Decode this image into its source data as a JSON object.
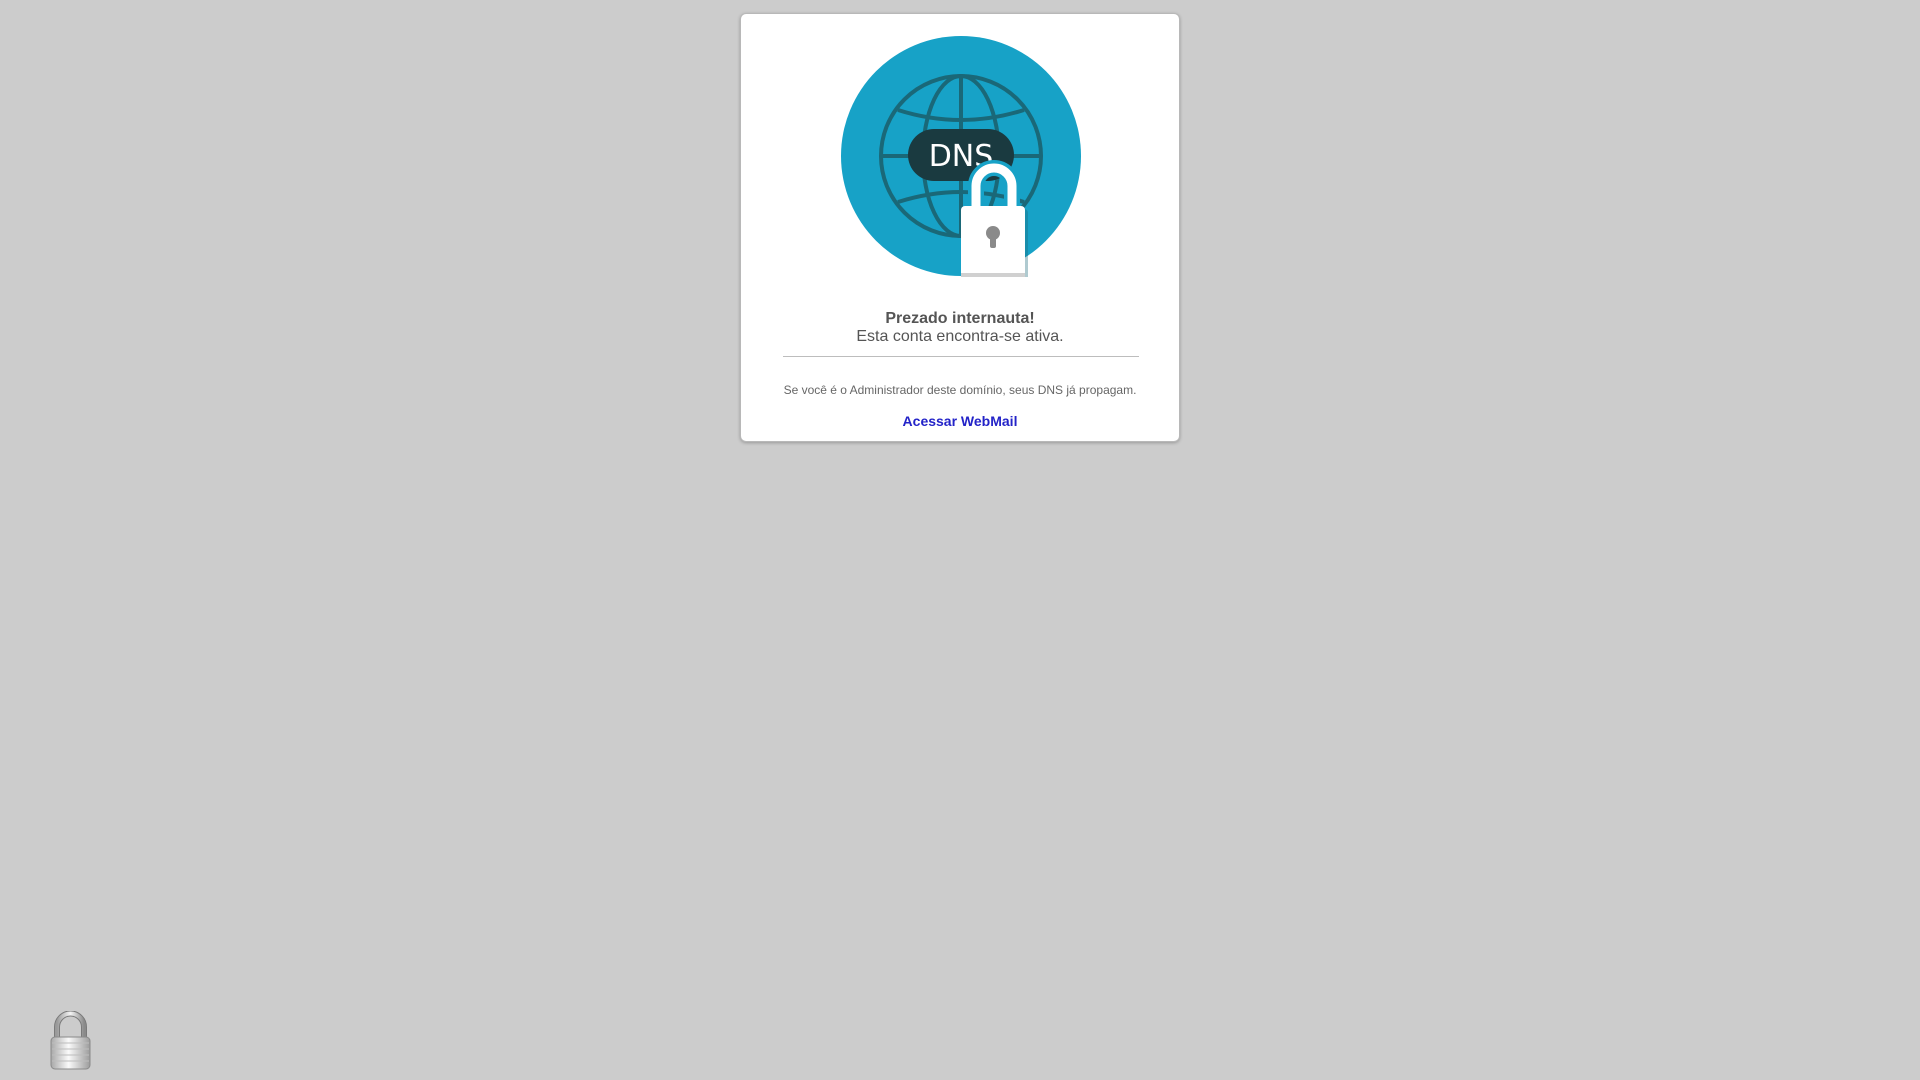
{
  "logo": {
    "badge_text": "DNS",
    "icon": "dns-globe-lock-icon",
    "colors": {
      "circle": "#17a2c7",
      "globe_lines": "#1a6878",
      "badge": "#1a3a40",
      "lock": "#ffffff"
    }
  },
  "message": {
    "heading": "Prezado internauta!",
    "subheading": "Esta conta encontra-se ativa.",
    "info": "Se você é o Administrador deste domínio, seus DNS já propagam."
  },
  "links": {
    "webmail": "Acessar WebMail"
  },
  "footer": {
    "icon": "padlock-icon"
  },
  "colors": {
    "background": "#cccccc",
    "card": "#ffffff",
    "link": "#2323c8",
    "text": "#555555"
  }
}
